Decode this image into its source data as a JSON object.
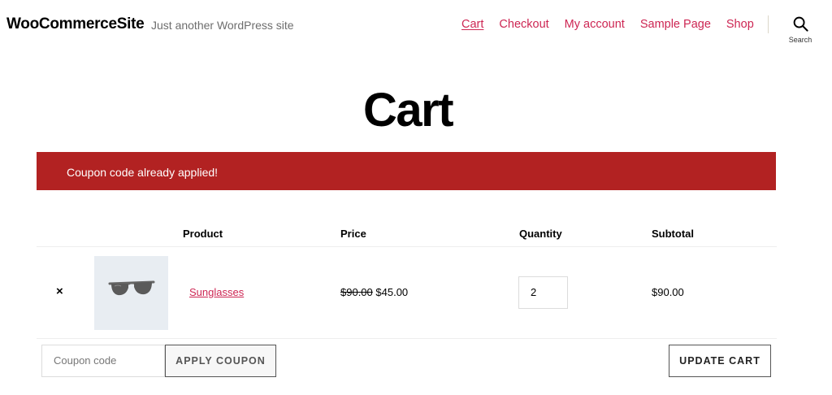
{
  "header": {
    "site_title": "WooCommerceSite",
    "site_description": "Just another WordPress site",
    "nav": [
      "Cart",
      "Checkout",
      "My account",
      "Sample Page",
      "Shop"
    ],
    "current_nav": "Cart",
    "search_label": "Search"
  },
  "page": {
    "title": "Cart"
  },
  "notice": {
    "text": "Coupon code already applied!",
    "color": "#b22222"
  },
  "table": {
    "headers": {
      "product": "Product",
      "price": "Price",
      "quantity": "Quantity",
      "subtotal": "Subtotal"
    },
    "rows": [
      {
        "remove": "×",
        "product": "Sunglasses",
        "thumbnail_icon": "sunglasses-image",
        "price_original": "$90.00",
        "price_sale": "$45.00",
        "quantity": "2",
        "subtotal": "$90.00"
      }
    ]
  },
  "actions": {
    "coupon_placeholder": "Coupon code",
    "apply_coupon_label": "APPLY COUPON",
    "update_cart_label": "UPDATE CART"
  },
  "colors": {
    "accent": "#cd2653",
    "error": "#b22222"
  }
}
